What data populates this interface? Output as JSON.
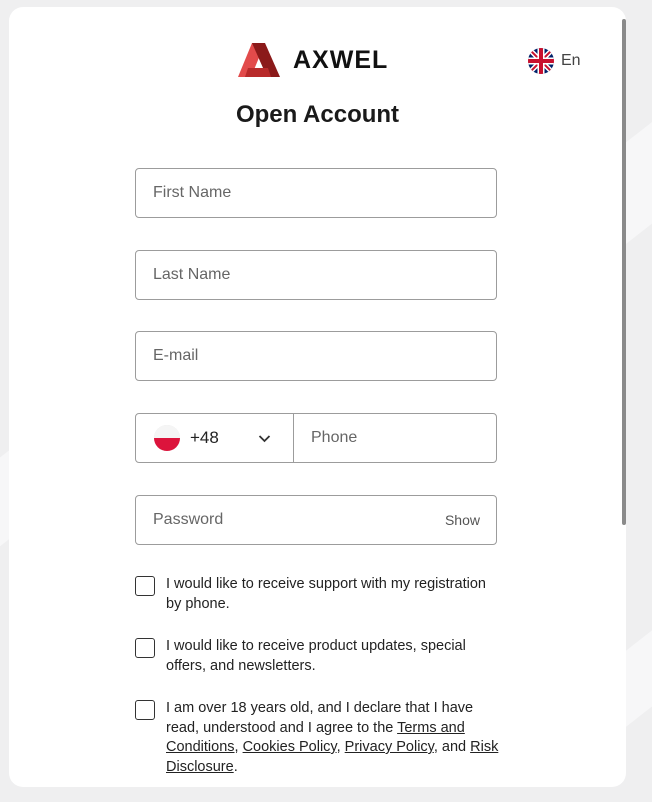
{
  "brand": {
    "name": "AXWEL",
    "logo_icon": "axwel-a-logo",
    "accent_color": "#e24b4b"
  },
  "language": {
    "label": "En",
    "icon": "uk-flag-icon"
  },
  "form": {
    "title": "Open Account",
    "first_name": {
      "placeholder": "First Name",
      "value": ""
    },
    "last_name": {
      "placeholder": "Last Name",
      "value": ""
    },
    "email": {
      "placeholder": "E-mail",
      "value": ""
    },
    "phone": {
      "country_flag": "poland-flag-icon",
      "dial_code": "+48",
      "placeholder": "Phone",
      "value": ""
    },
    "password": {
      "placeholder": "Password",
      "value": "",
      "show_label": "Show"
    }
  },
  "consents": [
    {
      "text": "I would like to receive support with my registration by phone.",
      "checked": false
    },
    {
      "text": "I would like to receive product updates, special offers, and newsletters.",
      "checked": false
    },
    {
      "checked": false,
      "text_start": "I am over 18 years old, and I declare that I have read, understood and I agree to the ",
      "link_terms": "Terms and Conditions",
      "sep_1": ", ",
      "link_cookies": "Cookies Policy",
      "sep_2": ", ",
      "link_privacy": "Privacy Policy",
      "sep_3": ", and ",
      "link_risk": "Risk Disclosure",
      "text_end": "."
    }
  ]
}
